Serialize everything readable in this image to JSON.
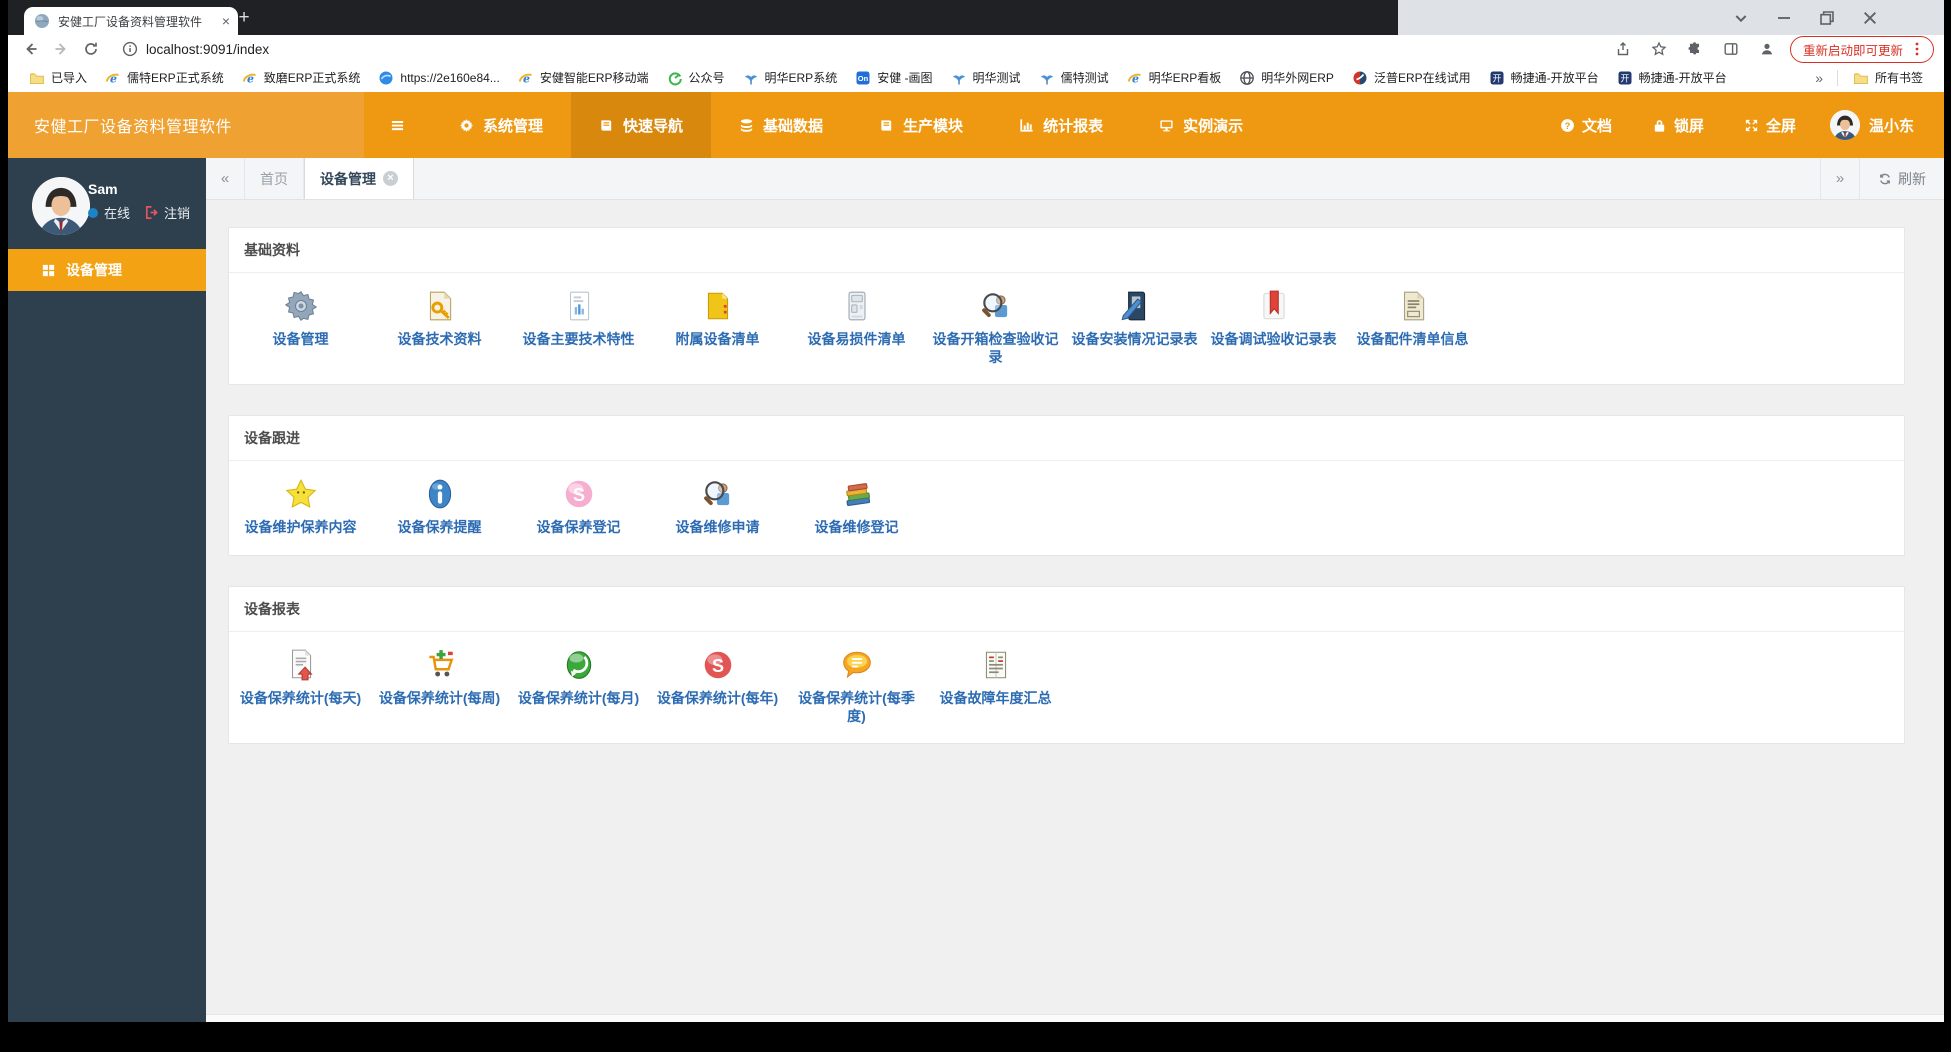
{
  "browser": {
    "tab": {
      "title": "安健工厂设备资料管理软件",
      "close": "×"
    },
    "new_tab": "+",
    "window_controls": [
      "chevron-down",
      "minimize",
      "restore",
      "close"
    ],
    "nav": {
      "url": "localhost:9091/index",
      "update_button": "重新启动即可更新"
    },
    "bookmarks": [
      {
        "icon": "folder-icon",
        "label": "已导入"
      },
      {
        "icon": "ie-icon",
        "label": "儒特ERP正式系统"
      },
      {
        "icon": "ie-icon",
        "label": "致磨ERP正式系统"
      },
      {
        "icon": "blue-globe-icon",
        "label": "https://2e160e84..."
      },
      {
        "icon": "ie-icon",
        "label": "安健智能ERP移动端"
      },
      {
        "icon": "green-icon",
        "label": "公众号"
      },
      {
        "icon": "leaf-icon",
        "label": "明华ERP系统"
      },
      {
        "icon": "on-icon",
        "label": "安健 -画图"
      },
      {
        "icon": "leaf-icon",
        "label": "明华测试"
      },
      {
        "icon": "leaf-icon",
        "label": "儒特测试"
      },
      {
        "icon": "ie-icon",
        "label": "明华ERP看板"
      },
      {
        "icon": "globe-icon",
        "label": "明华外网ERP"
      },
      {
        "icon": "fanpu-icon",
        "label": "泛普ERP在线试用"
      },
      {
        "icon": "kai-icon",
        "label": "畅捷通-开放平台"
      },
      {
        "icon": "kai-icon",
        "label": "畅捷通-开放平台"
      }
    ],
    "bookmarks_overflow": "»",
    "all_bookmarks": {
      "icon": "folder-icon",
      "label": "所有书签"
    }
  },
  "header": {
    "logo": "安健工厂设备资料管理软件",
    "nav": [
      {
        "icon": "gear-icon",
        "label": "系统管理",
        "active": false
      },
      {
        "icon": "book-icon",
        "label": "快速导航",
        "active": true
      },
      {
        "icon": "layers-icon",
        "label": "基础数据",
        "active": false
      },
      {
        "icon": "book-icon",
        "label": "生产模块",
        "active": false
      },
      {
        "icon": "chart-icon",
        "label": "统计报表",
        "active": false
      },
      {
        "icon": "monitor-icon",
        "label": "实例演示",
        "active": false
      }
    ],
    "right": [
      {
        "icon": "help-icon",
        "label": "文档"
      },
      {
        "icon": "lock-icon",
        "label": "锁屏"
      },
      {
        "icon": "expand-icon",
        "label": "全屏"
      }
    ],
    "user": {
      "name": "温小东"
    }
  },
  "sidebar": {
    "user": {
      "name": "Sam",
      "status": "在线",
      "logout": "注销"
    },
    "menu": [
      {
        "icon": "grid-icon",
        "label": "设备管理",
        "active": true
      }
    ]
  },
  "tabbar": {
    "scroll_left": "«",
    "scroll_right": "»",
    "tabs": [
      {
        "label": "首页",
        "active": false,
        "closable": false
      },
      {
        "label": "设备管理",
        "active": true,
        "closable": true
      }
    ],
    "refresh": "刷新"
  },
  "panels": [
    {
      "title": "基础资料",
      "items": [
        {
          "icon": "gear-gray-icon",
          "label": "设备管理"
        },
        {
          "icon": "doc-key-icon",
          "label": "设备技术资料"
        },
        {
          "icon": "doc-chart-icon",
          "label": "设备主要技术特性"
        },
        {
          "icon": "folder-yellow-icon",
          "label": "附属设备清单"
        },
        {
          "icon": "machine-icon",
          "label": "设备易损件清单"
        },
        {
          "icon": "search-person-icon",
          "label": "设备开箱检查验收记录"
        },
        {
          "icon": "book-pen-icon",
          "label": "设备安装情况记录表"
        },
        {
          "icon": "bookmark-red-icon",
          "label": "设备调试验收记录表"
        },
        {
          "icon": "doc-lines-icon",
          "label": "设备配件清单信息"
        }
      ]
    },
    {
      "title": "设备跟进",
      "items": [
        {
          "icon": "star-icon",
          "label": "设备维护保养内容"
        },
        {
          "icon": "info-icon",
          "label": "设备保养提醒"
        },
        {
          "icon": "s-pink-icon",
          "label": "设备保养登记"
        },
        {
          "icon": "search-person-icon",
          "label": "设备维修申请"
        },
        {
          "icon": "books-icon",
          "label": "设备维修登记"
        }
      ]
    },
    {
      "title": "设备报表",
      "items": [
        {
          "icon": "doc-arrow-icon",
          "label": "设备保养统计(每天)"
        },
        {
          "icon": "cart-icon",
          "label": "设备保养统计(每周)"
        },
        {
          "icon": "orb-green-icon",
          "label": "设备保养统计(每月)"
        },
        {
          "icon": "s-red-icon",
          "label": "设备保养统计(每年)"
        },
        {
          "icon": "bubble-icon",
          "label": "设备保养统计(每季度)"
        },
        {
          "icon": "doc-news-icon",
          "label": "设备故障年度汇总"
        }
      ]
    }
  ],
  "colors": {
    "accent_orange": "#ef9913",
    "header_active": "#d9880e",
    "sidebar_bg": "#2e3f4e",
    "sidebar_active": "#f3a213",
    "link_blue": "#2d6cb2",
    "online_dot": "#1c84c6",
    "update_red": "#d93025",
    "content_bg": "#f0f0f1"
  }
}
